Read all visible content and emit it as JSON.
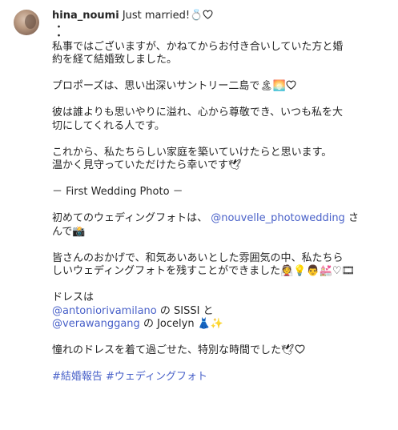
{
  "post": {
    "username": "hina_noumi",
    "headline": " Just married!",
    "headline_emoji": "💍",
    "dots": [
      "・",
      "・"
    ],
    "p1_l1": "私事ではございますが、かねてからお付き合いしていた方と婚",
    "p1_l2": "約を経て結婚致しました。",
    "p2": "プロポーズは、思い出深いサントリー二島で",
    "p2_emoji": "🏝🌅",
    "p3_l1": "彼は誰よりも思いやりに溢れ、心から尊敬でき、いつも私を大",
    "p3_l2": "切にしてくれる人です。",
    "p4_l1": "これから、私たちらしい家庭を築いていけたらと思います。",
    "p4_l2": "温かく見守っていただけたら幸いです",
    "p4_emoji": "🕊",
    "section_title": "－ First Wedding Photo －",
    "p5_l1_pre": "初めてのウェディングフォトは、 ",
    "p5_mention": "@nouvelle_photowedding",
    "p5_l1_post": " さ",
    "p5_l2": "んで",
    "p5_emoji": "📸",
    "p6_l1": "皆さんのおかげで、和気あいあいとした雰囲気の中、私たちら",
    "p6_l2": "しいウェディングフォトを残すことができました",
    "p6_emoji": "👰💡👨💒♡🎞",
    "dress_label": "ドレスは",
    "dress_mention1": "@antoniorivamilano",
    "dress_text1": " の SISSI と",
    "dress_mention2": "@verawanggang",
    "dress_text2": " の Jocelyn ",
    "dress_emoji": "👗✨",
    "p7": "憧れのドレスを着て過ごせた、特別な時間でした",
    "p7_emoji": "🕊",
    "hashtags": "#結婚報告 #ウェディングフォト"
  }
}
